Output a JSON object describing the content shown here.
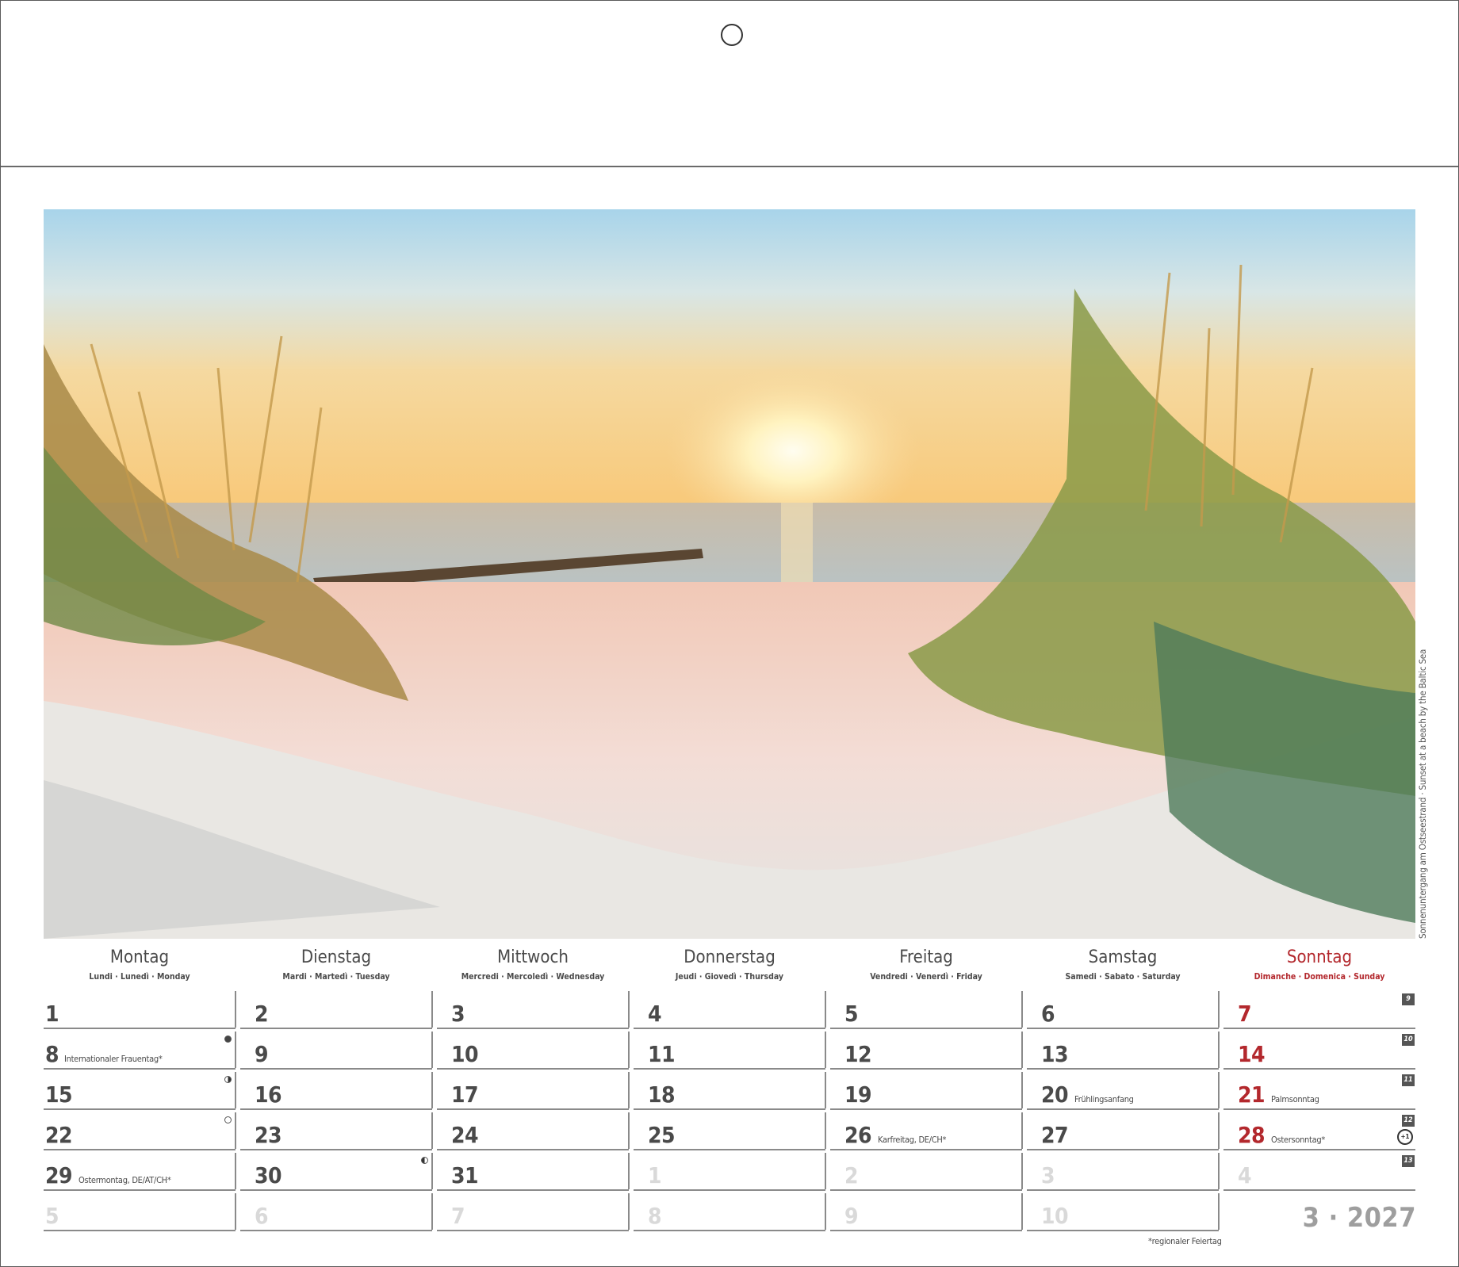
{
  "photo": {
    "caption": "Sonnenuntergang am Ostseestrand · Sunset at a beach by the Baltic Sea"
  },
  "weekdays": [
    {
      "name": "Montag",
      "sub": "Lundi · Lunedì · Monday"
    },
    {
      "name": "Dienstag",
      "sub": "Mardi · Martedì · Tuesday"
    },
    {
      "name": "Mittwoch",
      "sub": "Mercredi · Mercoledì · Wednesday"
    },
    {
      "name": "Donnerstag",
      "sub": "Jeudi · Giovedì · Thursday"
    },
    {
      "name": "Freitag",
      "sub": "Vendredi · Venerdì · Friday"
    },
    {
      "name": "Samstag",
      "sub": "Samedi · Sabato · Saturday"
    },
    {
      "name": "Sonntag",
      "sub": "Dimanche · Domenica · Sunday"
    }
  ],
  "weeks": [
    {
      "week_no": "9",
      "days": [
        {
          "d": "1"
        },
        {
          "d": "2"
        },
        {
          "d": "3"
        },
        {
          "d": "4"
        },
        {
          "d": "5"
        },
        {
          "d": "6"
        },
        {
          "d": "7",
          "red": true
        }
      ]
    },
    {
      "week_no": "10",
      "days": [
        {
          "d": "8",
          "note": "Internationaler Frauentag*",
          "moon": "new"
        },
        {
          "d": "9"
        },
        {
          "d": "10"
        },
        {
          "d": "11"
        },
        {
          "d": "12"
        },
        {
          "d": "13"
        },
        {
          "d": "14",
          "red": true
        }
      ]
    },
    {
      "week_no": "11",
      "days": [
        {
          "d": "15",
          "moon": "half"
        },
        {
          "d": "16"
        },
        {
          "d": "17"
        },
        {
          "d": "18"
        },
        {
          "d": "19"
        },
        {
          "d": "20",
          "note": "Frühlingsanfang"
        },
        {
          "d": "21",
          "red": true,
          "note": "Palmsonntag"
        }
      ]
    },
    {
      "week_no": "12",
      "days": [
        {
          "d": "22",
          "moon": "full"
        },
        {
          "d": "23"
        },
        {
          "d": "24"
        },
        {
          "d": "25"
        },
        {
          "d": "26",
          "note": "Karfreitag, DE/CH*"
        },
        {
          "d": "27"
        },
        {
          "d": "28",
          "red": true,
          "note": "Ostersonntag*",
          "icon": "clock-change-icon"
        }
      ]
    },
    {
      "week_no": "13",
      "days": [
        {
          "d": "29",
          "note": "Ostermontag, DE/AT/CH*"
        },
        {
          "d": "30",
          "moon": "half2"
        },
        {
          "d": "31"
        },
        {
          "d": "1",
          "faded": true
        },
        {
          "d": "2",
          "faded": true
        },
        {
          "d": "3",
          "faded": true
        },
        {
          "d": "4",
          "faded": true
        }
      ]
    },
    {
      "week_no": "",
      "days": [
        {
          "d": "5",
          "faded": true
        },
        {
          "d": "6",
          "faded": true
        },
        {
          "d": "7",
          "faded": true
        },
        {
          "d": "8",
          "faded": true
        },
        {
          "d": "9",
          "faded": true
        },
        {
          "d": "10",
          "faded": true
        }
      ]
    }
  ],
  "footnote": "*regionaler Feiertag",
  "month_year": "3 · 2027",
  "colors": {
    "sunday": "#b3282d",
    "text": "#4a4a4a",
    "faded": "#d9d9d9",
    "rule": "#8a8a8a"
  }
}
